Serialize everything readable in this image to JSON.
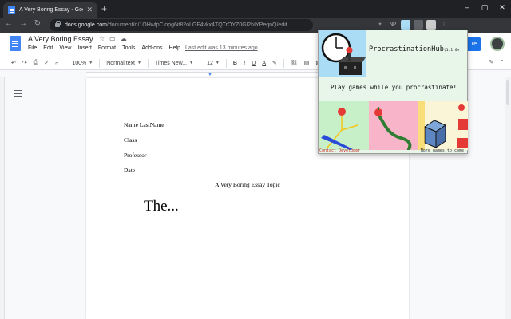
{
  "browser": {
    "tab_title": "A Very Boring Essay - Google Do",
    "tab_close": "✕",
    "new_tab": "+",
    "url_host": "docs.google.com",
    "url_path": "/document/d/1OHwfpClopg6it82oLGF4vkx4TQTrOYZ0Gl2hIYPeqnQ/edit",
    "extensions": [
      "NP"
    ]
  },
  "docs": {
    "title": "A Very Boring Essay",
    "menu": [
      "File",
      "Edit",
      "View",
      "Insert",
      "Format",
      "Tools",
      "Add-ons",
      "Help"
    ],
    "last_edit": "Last edit was 13 minutes ago",
    "share_label": "re",
    "toolbar": {
      "zoom": "100%",
      "style": "Normal text",
      "font": "Times New...",
      "size": "12",
      "bold": "B",
      "italic": "I",
      "underline": "U",
      "text_color": "A"
    }
  },
  "document": {
    "lines": [
      "Name LastName",
      "Class",
      "Professor",
      "Date"
    ],
    "heading": "A Very Boring Essay Topic",
    "body": "The..."
  },
  "popup": {
    "title": "ProcrastinationHub",
    "version": "(1.1.0)",
    "tagline": "Play games while you procrastinate!",
    "contact": "Contact Developer",
    "more": "More games to come!"
  }
}
